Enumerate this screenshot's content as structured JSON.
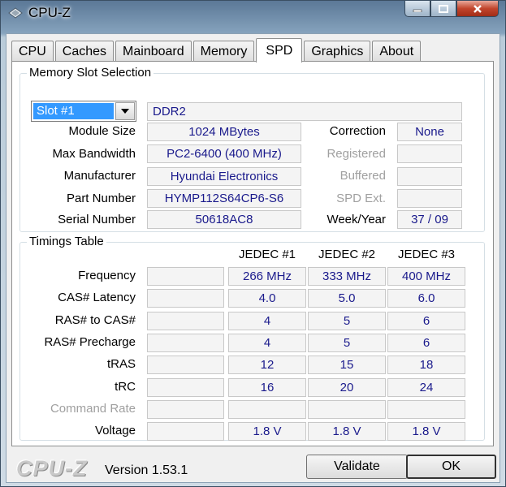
{
  "window": {
    "title": "CPU-Z"
  },
  "tabs": [
    "CPU",
    "Caches",
    "Mainboard",
    "Memory",
    "SPD",
    "Graphics",
    "About"
  ],
  "slot": {
    "group_title": "Memory Slot Selection",
    "selected": "Slot #1",
    "type": "DDR2",
    "module_size_label": "Module Size",
    "module_size": "1024 MBytes",
    "max_bw_label": "Max Bandwidth",
    "max_bw": "PC2-6400 (400 MHz)",
    "manufacturer_label": "Manufacturer",
    "manufacturer": "Hyundai Electronics",
    "part_label": "Part Number",
    "part": "HYMP112S64CP6-S6",
    "serial_label": "Serial Number",
    "serial": "50618AC8",
    "correction_label": "Correction",
    "correction": "None",
    "registered_label": "Registered",
    "buffered_label": "Buffered",
    "spd_ext_label": "SPD Ext.",
    "week_year_label": "Week/Year",
    "week_year": "37 / 09"
  },
  "timings": {
    "group_title": "Timings Table",
    "headers": [
      "JEDEC #1",
      "JEDEC #2",
      "JEDEC #3"
    ],
    "rows": [
      {
        "label": "Frequency",
        "values": [
          "266 MHz",
          "333 MHz",
          "400 MHz"
        ]
      },
      {
        "label": "CAS# Latency",
        "values": [
          "4.0",
          "5.0",
          "6.0"
        ]
      },
      {
        "label": "RAS# to CAS#",
        "values": [
          "4",
          "5",
          "6"
        ]
      },
      {
        "label": "RAS# Precharge",
        "values": [
          "4",
          "5",
          "6"
        ]
      },
      {
        "label": "tRAS",
        "values": [
          "12",
          "15",
          "18"
        ]
      },
      {
        "label": "tRC",
        "values": [
          "16",
          "20",
          "24"
        ]
      },
      {
        "label": "Command Rate",
        "values": [
          "",
          "",
          ""
        ]
      },
      {
        "label": "Voltage",
        "values": [
          "1.8 V",
          "1.8 V",
          "1.8 V"
        ]
      }
    ]
  },
  "footer": {
    "logo": "CPU-Z",
    "version": "Version 1.53.1",
    "validate": "Validate",
    "ok": "OK"
  },
  "icons": {
    "app": "cpu-z-diamond-icon",
    "minimize": "minimize-icon",
    "maximize": "maximize-icon",
    "close": "close-icon",
    "dropdown": "chevron-down-icon"
  }
}
